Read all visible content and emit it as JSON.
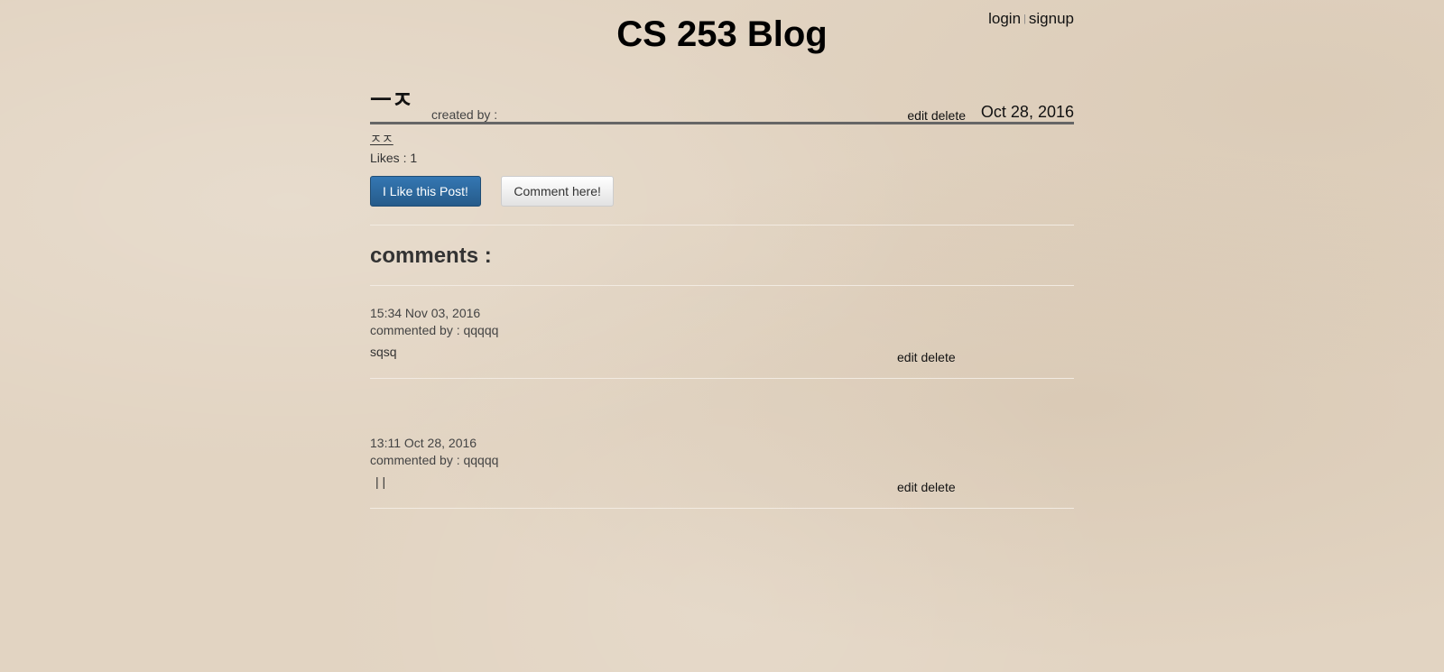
{
  "site": {
    "title": "CS 253 Blog",
    "login": "login",
    "separator": "|",
    "signup": "signup"
  },
  "post": {
    "title": "ㅡㅈ",
    "created_by": "created by :",
    "edit": "edit",
    "delete": "delete",
    "date": "Oct 28, 2016",
    "body": "ㅈㅈ",
    "likes": "Likes : 1",
    "like_button": "I Like this Post!",
    "comment_button": "Comment here!"
  },
  "comments_heading": "comments :",
  "comments": [
    {
      "time": "15:34 Nov 03, 2016",
      "author": "commented by : qqqqq",
      "body": "sqsq",
      "edit": "edit",
      "delete": "delete"
    },
    {
      "time": "13:11 Oct 28, 2016",
      "author": "commented by : qqqqq",
      "body": "| |",
      "edit": "edit",
      "delete": "delete"
    }
  ]
}
